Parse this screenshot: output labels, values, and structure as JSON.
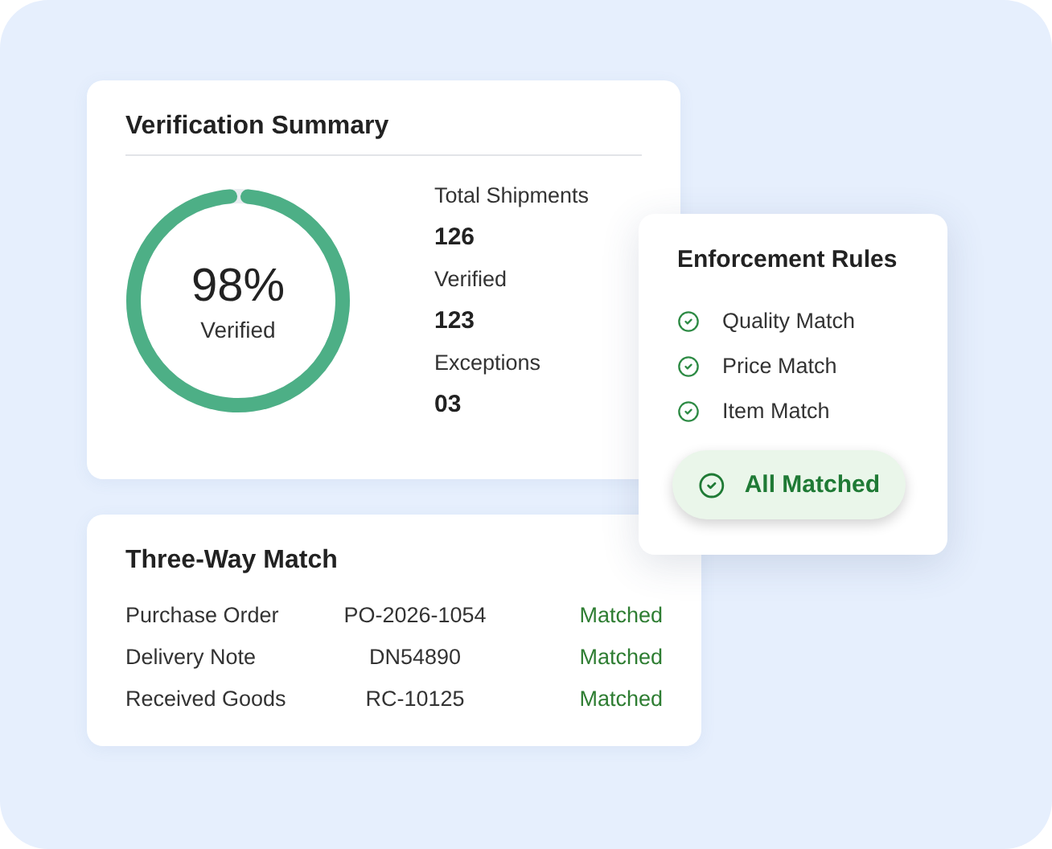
{
  "summary": {
    "title": "Verification Summary",
    "ring": {
      "level": 0.98,
      "percent": "98%",
      "label": "Verified"
    },
    "stats": [
      {
        "label": "Total Shipments",
        "value": "126"
      },
      {
        "label": "Verified",
        "value": "123"
      },
      {
        "label": "Exceptions",
        "value": "03"
      }
    ]
  },
  "rules": {
    "title": "Enforcement Rules",
    "items": [
      {
        "label": "Quality Match",
        "checked": true
      },
      {
        "label": "Price Match",
        "checked": true
      },
      {
        "label": "Item Match",
        "checked": true
      }
    ],
    "button": "All Matched"
  },
  "match": {
    "title": "Three-Way Match",
    "rows": [
      {
        "document": "Purchase Order",
        "reference": "PO-2026-1054",
        "status": "Matched"
      },
      {
        "document": "Delivery Note",
        "reference": "DN54890",
        "status": "Matched"
      },
      {
        "document": "Received Goods",
        "reference": "RC-10125",
        "status": "Matched"
      }
    ]
  }
}
